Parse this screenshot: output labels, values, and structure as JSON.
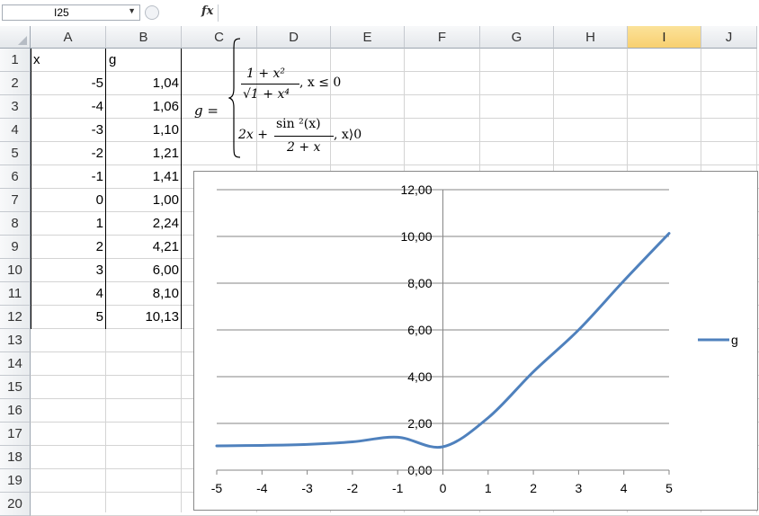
{
  "formula_bar": {
    "name_box": "I25",
    "fx_label": "fx",
    "formula": ""
  },
  "columns": [
    "A",
    "B",
    "C",
    "D",
    "E",
    "F",
    "G",
    "H",
    "I",
    "J"
  ],
  "selected_column": "I",
  "rows": [
    "1",
    "2",
    "3",
    "4",
    "5",
    "6",
    "7",
    "8",
    "9",
    "10",
    "11",
    "12",
    "13",
    "14",
    "15",
    "16",
    "17",
    "18",
    "19",
    "20"
  ],
  "table": {
    "headers": [
      "x",
      "g"
    ],
    "rows": [
      [
        "-5",
        "1,04"
      ],
      [
        "-4",
        "1,06"
      ],
      [
        "-3",
        "1,10"
      ],
      [
        "-2",
        "1,21"
      ],
      [
        "-1",
        "1,41"
      ],
      [
        "0",
        "1,00"
      ],
      [
        "1",
        "2,24"
      ],
      [
        "2",
        "4,21"
      ],
      [
        "3",
        "6,00"
      ],
      [
        "4",
        "8,10"
      ],
      [
        "5",
        "10,13"
      ]
    ]
  },
  "equation": {
    "lhs": "g =",
    "case1_num": "1 + x²",
    "case1_den": "√1 + x⁴",
    "case1_cond": ", x ≤ 0",
    "case2_pre": "2x +",
    "case2_num": "sin ²(x)",
    "case2_den": "2 + x",
    "case2_cond": ", x⟩0"
  },
  "chart_data": {
    "type": "line",
    "x": [
      -5,
      -4,
      -3,
      -2,
      -1,
      0,
      1,
      2,
      3,
      4,
      5
    ],
    "series": [
      {
        "name": "g",
        "values": [
          1.04,
          1.06,
          1.1,
          1.21,
          1.41,
          1.0,
          2.24,
          4.21,
          6.0,
          8.1,
          10.13
        ],
        "color": "#4f81bd"
      }
    ],
    "xticks": [
      "-5",
      "-4",
      "-3",
      "-2",
      "-1",
      "0",
      "1",
      "2",
      "3",
      "4",
      "5"
    ],
    "yticks": [
      "0,00",
      "2,00",
      "4,00",
      "6,00",
      "8,00",
      "10,00",
      "12,00"
    ],
    "ylim": [
      0,
      12
    ],
    "xlim": [
      -5,
      5
    ],
    "grid": true,
    "legend": "right",
    "smooth": true
  }
}
